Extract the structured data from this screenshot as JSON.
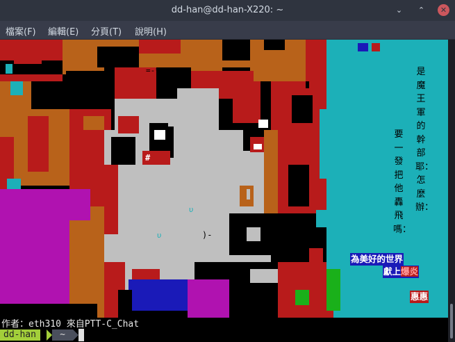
{
  "window": {
    "title": "dd-han@dd-han-X220: ~"
  },
  "controls": {
    "minimize_glyph": "⌄",
    "maximize_glyph": "⌃",
    "close_glyph": "✕"
  },
  "menu": [
    {
      "label": "檔案(F)"
    },
    {
      "label": "編輯(E)"
    },
    {
      "label": "分頁(T)"
    },
    {
      "label": "說明(H)"
    }
  ],
  "art": {
    "vertical_text_right": "是魔王軍的幹部耶：怎麼辦：",
    "vertical_text_left": "要一發把他轟飛嗎：",
    "label_line1": "為美好的世界",
    "label_line2_prefix": "獻上",
    "label_line2_highlight": "爆炎",
    "label_signature": "惠惠",
    "face_marks": {
      "hash": "#",
      "u1": "υ",
      "u2": "υ",
      "mouth": ")-",
      "dash": "=-*"
    }
  },
  "terminal": {
    "author_line": "作者：eth310 來自PTT-C_Chat",
    "prompt_user": "dd-han",
    "prompt_dir": "~"
  },
  "colors": {
    "titlebar": "#2f343f",
    "menubar": "#383c4a",
    "prompt_green": "#a3cf3a",
    "art_cyan": "#1cb0b8",
    "art_brown": "#b8621a",
    "art_red": "#b81b1b",
    "art_gray": "#bfbfbf",
    "art_magenta": "#b012b0",
    "art_blue": "#1a1ab8"
  }
}
